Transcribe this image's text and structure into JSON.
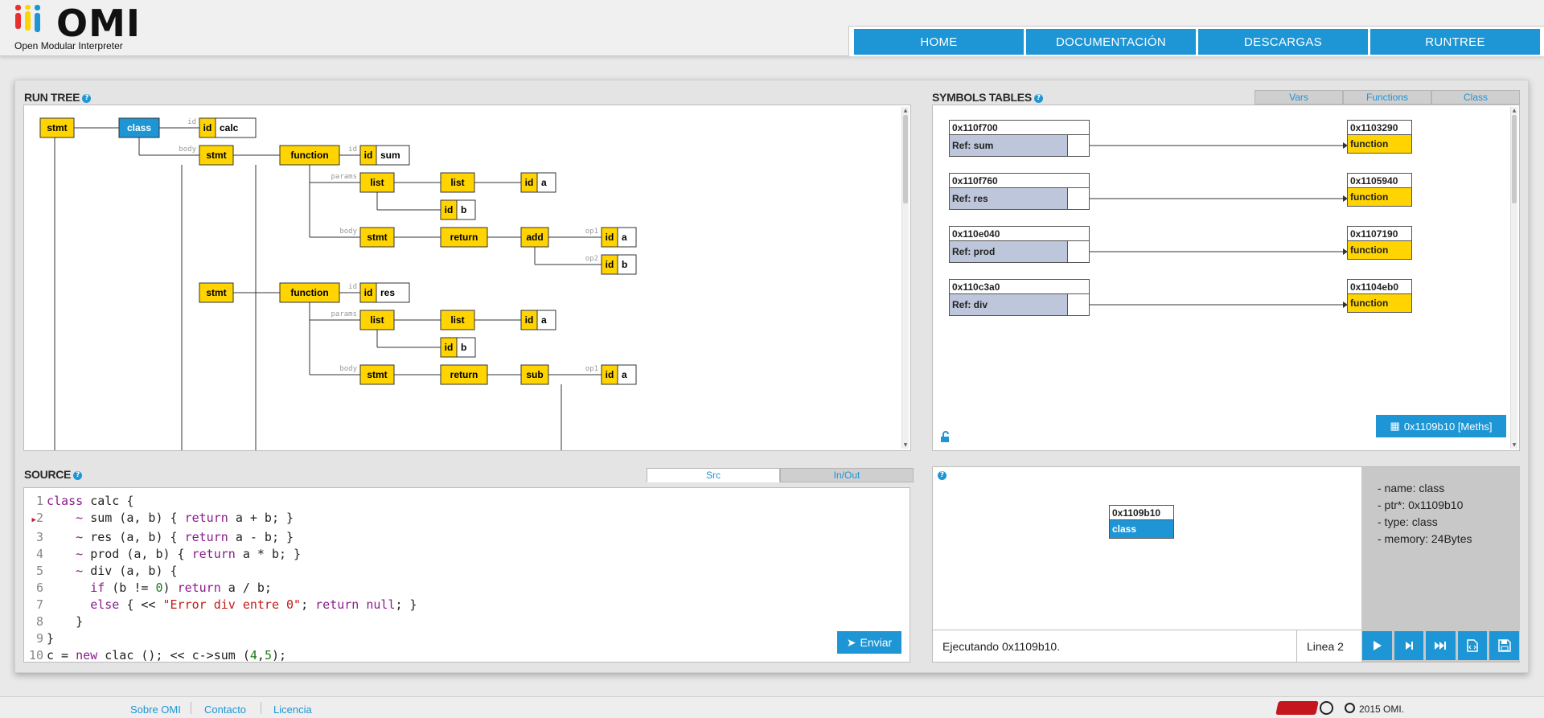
{
  "brand": {
    "name": "OMI",
    "subtitle": "Open Modular Interpreter"
  },
  "nav": [
    "HOME",
    "DOCUMENTACIÓN",
    "DESCARGAS",
    "RUNTREE"
  ],
  "runtree": {
    "title": "RUN TREE",
    "help": "?",
    "nodes": [
      {
        "label": "stmt",
        "type": "op"
      },
      {
        "label": "class",
        "type": "class"
      },
      {
        "label": "id",
        "value": "calc",
        "edge": "id"
      },
      {
        "label": "stmt",
        "type": "op",
        "edge": "body"
      },
      {
        "label": "function",
        "type": "op"
      },
      {
        "label": "id",
        "value": "sum",
        "edge": "id"
      },
      {
        "label": "list",
        "type": "op",
        "edge": "params"
      },
      {
        "label": "list",
        "type": "op"
      },
      {
        "label": "id",
        "value": "a"
      },
      {
        "label": "id",
        "value": "b"
      },
      {
        "label": "stmt",
        "type": "op",
        "edge": "body"
      },
      {
        "label": "return",
        "type": "op"
      },
      {
        "label": "add",
        "type": "op"
      },
      {
        "label": "id",
        "value": "a",
        "edge": "op1"
      },
      {
        "label": "id",
        "value": "b",
        "edge": "op2"
      },
      {
        "label": "stmt",
        "type": "op"
      },
      {
        "label": "function",
        "type": "op"
      },
      {
        "label": "id",
        "value": "res",
        "edge": "id"
      },
      {
        "label": "list",
        "type": "op",
        "edge": "params"
      },
      {
        "label": "list",
        "type": "op"
      },
      {
        "label": "id",
        "value": "a"
      },
      {
        "label": "id",
        "value": "b"
      },
      {
        "label": "stmt",
        "type": "op",
        "edge": "body"
      },
      {
        "label": "return",
        "type": "op"
      },
      {
        "label": "sub",
        "type": "op"
      },
      {
        "label": "id",
        "value": "a",
        "edge": "op1"
      }
    ]
  },
  "symbols": {
    "title": "SYMBOLS TABLES",
    "help": "?",
    "tabs": [
      "Vars",
      "Functions",
      "Class"
    ],
    "entries": [
      {
        "addr": "0x110f700",
        "ref": "Ref: sum",
        "target_addr": "0x1103290",
        "target_type": "function"
      },
      {
        "addr": "0x110f760",
        "ref": "Ref: res",
        "target_addr": "0x1105940",
        "target_type": "function"
      },
      {
        "addr": "0x110e040",
        "ref": "Ref: prod",
        "target_addr": "0x1107190",
        "target_type": "function"
      },
      {
        "addr": "0x110c3a0",
        "ref": "Ref: div",
        "target_addr": "0x1104eb0",
        "target_type": "function"
      }
    ],
    "meths_button": "0x1109b10 [Meths]",
    "lock_icon": "unlock-icon"
  },
  "source": {
    "title": "SOURCE",
    "help": "?",
    "tabs": [
      "Src",
      "In/Out"
    ],
    "current_line": 2,
    "send_label": "Enviar",
    "lines": [
      [
        [
          "class ",
          "kw"
        ],
        [
          "calc {",
          ""
        ]
      ],
      [
        [
          "    ",
          ""
        ],
        [
          "~ ",
          "kw"
        ],
        [
          "sum (a, b) { ",
          ""
        ],
        [
          "return ",
          "kw"
        ],
        [
          "a + b; }",
          ""
        ]
      ],
      [
        [
          "    ",
          ""
        ],
        [
          "~ ",
          "kw"
        ],
        [
          "res (a, b) { ",
          ""
        ],
        [
          "return ",
          "kw"
        ],
        [
          "a - b; }",
          ""
        ]
      ],
      [
        [
          "    ",
          ""
        ],
        [
          "~ ",
          "kw"
        ],
        [
          "prod (a, b) { ",
          ""
        ],
        [
          "return ",
          "kw"
        ],
        [
          "a * b; }",
          ""
        ]
      ],
      [
        [
          "    ",
          ""
        ],
        [
          "~ ",
          "kw"
        ],
        [
          "div (a, b) {",
          ""
        ]
      ],
      [
        [
          "      ",
          ""
        ],
        [
          "if ",
          "kw"
        ],
        [
          "(b != ",
          ""
        ],
        [
          "0",
          "num"
        ],
        [
          ") ",
          ""
        ],
        [
          "return ",
          "kw"
        ],
        [
          "a / b;",
          ""
        ]
      ],
      [
        [
          "      ",
          ""
        ],
        [
          "else ",
          "kw"
        ],
        [
          "{ << ",
          ""
        ],
        [
          "\"Error div entre 0\"",
          "str"
        ],
        [
          "; ",
          ""
        ],
        [
          "return ",
          "kw"
        ],
        [
          "null",
          "kw"
        ],
        [
          "; }",
          ""
        ]
      ],
      [
        [
          "    }",
          ""
        ]
      ],
      [
        [
          "}",
          ""
        ]
      ],
      [
        [
          "c = ",
          ""
        ],
        [
          "new ",
          "kw"
        ],
        [
          "clac (); << c->sum (",
          ""
        ],
        [
          "4",
          "num"
        ],
        [
          ",",
          ""
        ],
        [
          "5",
          "num"
        ],
        [
          ");",
          ""
        ]
      ]
    ]
  },
  "inspector": {
    "help": "?",
    "object": {
      "addr": "0x1109b10",
      "type": "class"
    },
    "info": [
      "- name: class",
      "- ptr*: 0x1109b10",
      "- type: class",
      "- memory: 24Bytes"
    ],
    "status": "Ejecutando 0x1109b10.",
    "line": "Linea 2",
    "controls": [
      "play-icon",
      "step-icon",
      "fast-forward-icon",
      "code-file-icon",
      "save-icon"
    ]
  },
  "footer": {
    "links": [
      "Sobre OMI",
      "Contacto",
      "Licencia"
    ],
    "copyright": "2015 OMI."
  },
  "colors": {
    "accent": "#1e95d4",
    "node": "#ffd400",
    "class_node": "#1e95d4",
    "ref": "#bdc6da"
  }
}
